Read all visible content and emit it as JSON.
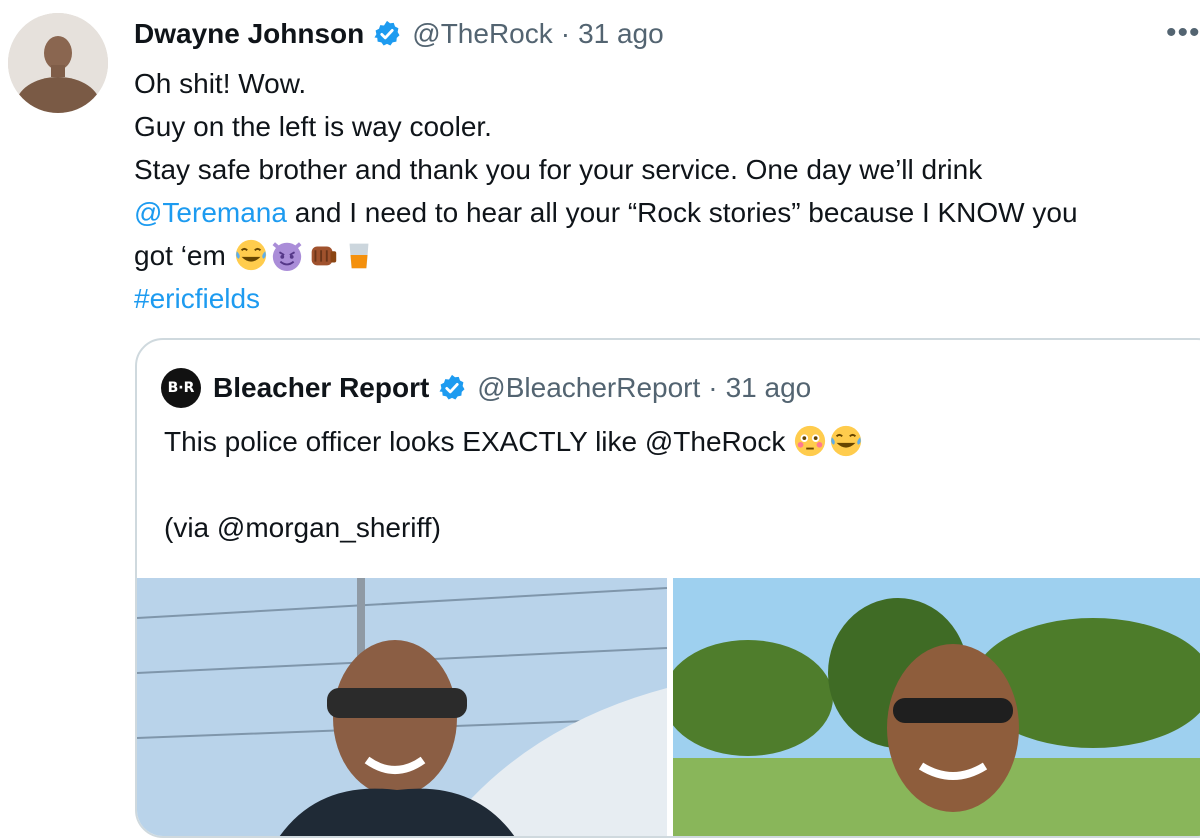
{
  "tweet": {
    "author_name": "Dwayne Johnson",
    "handle": "@TheRock",
    "separator": "·",
    "time": "31 ago",
    "more": "•••",
    "lines": {
      "l1": "Oh shit! Wow.",
      "l2": "Guy on the left is way cooler.",
      "l3": "Stay safe brother and thank you for your service. One day we’ll drink",
      "l4_mention": "@Teremana",
      "l4_rest": " and I need to hear all your “Rock stories” because I KNOW you",
      "l5": "got ‘em ",
      "l6_hashtag": "#ericfields"
    },
    "emojis": [
      "tears-of-joy",
      "smiling-imp",
      "fist-bump",
      "tumbler-glass"
    ]
  },
  "quote": {
    "logo_text": "B·R",
    "author_name": "Bleacher Report",
    "handle": "@BleacherReport",
    "separator": "·",
    "time": "31 ago",
    "text_line1": "This police officer looks EXACTLY like @TheRock ",
    "text_line2": "(via @morgan_sheriff)",
    "emojis": [
      "flushed",
      "tears-of-joy"
    ],
    "photos": [
      "police-officer-photo",
      "dwayne-johnson-photo"
    ]
  },
  "colors": {
    "link": "#1d9bf0",
    "verified": "#1d9bf0",
    "secondary_text": "#536471",
    "border": "#cfd9de"
  }
}
